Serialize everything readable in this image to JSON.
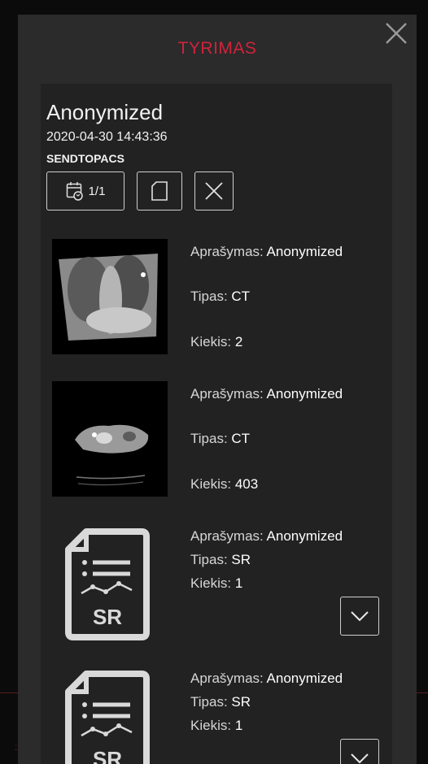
{
  "modal": {
    "title": "TYRIMAS"
  },
  "study": {
    "name": "Anonymized",
    "datetime": "2020-04-30 14:43:36",
    "aet": "SENDTOPACS",
    "series_counter": "1/1"
  },
  "labels": {
    "description": "Aprašymas:",
    "type": "Tipas:",
    "count": "Kiekis:"
  },
  "series": [
    {
      "thumbnail": "chest-xray-thumbnail",
      "description": "Anonymized",
      "type": "CT",
      "count": "2"
    },
    {
      "thumbnail": "ct-axial-thumbnail",
      "description": "Anonymized",
      "type": "CT",
      "count": "403"
    },
    {
      "thumbnail": "sr-document-icon",
      "icon_text": "SR",
      "description": "Anonymized",
      "type": "SR",
      "count": "1"
    },
    {
      "thumbnail": "sr-document-icon",
      "icon_text": "SR",
      "description": "Anonymized",
      "type": "SR",
      "count": "1"
    }
  ],
  "colors": {
    "accent": "#d0233a",
    "panel": "#2b2b2b",
    "card": "#222222"
  },
  "icons": [
    "close-icon",
    "calendar-refresh-icon",
    "copy-icon",
    "remove-icon",
    "chevron-down-icon"
  ]
}
